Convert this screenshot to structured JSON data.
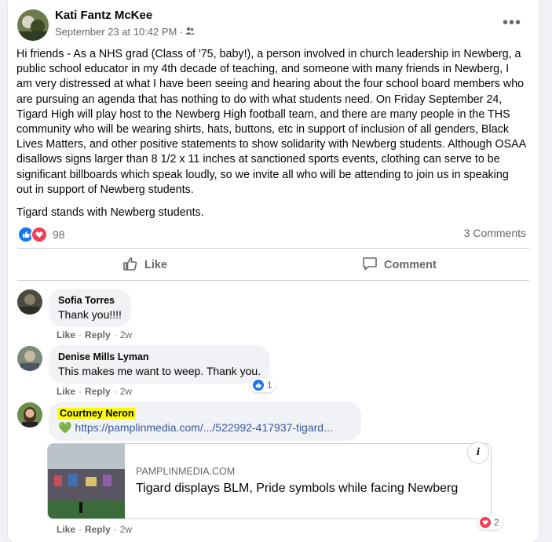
{
  "post": {
    "author": "Kati Fantz McKee",
    "timestamp": "September 23 at 10:42 PM",
    "privacy_icon": "friends-icon",
    "more_label": "•••",
    "paragraph1": "Hi friends - As a NHS grad (Class of '75, baby!), a person involved in church leadership in Newberg, a public school educator in my 4th decade of teaching, and someone with many friends in Newberg, I am very distressed at what I have been seeing and hearing about the four school board members who are pursuing an agenda that has nothing to do with what students need. On Friday September 24, Tigard High will play host to the Newberg High football team, and there are many people in the THS community who will be wearing shirts, hats, buttons, etc in support of inclusion of all genders, Black Lives Matters, and other positive statements to show solidarity with Newberg students. Although OSAA disallows signs larger than 8 1/2 x 11 inches at sanctioned sports events, clothing can serve to be significant billboards which speak loudly, so we invite all who will be attending to join us in speaking out in support of Newberg students.",
    "paragraph2": "Tigard stands with Newberg students.",
    "reaction_count": "98",
    "comments_count": "3 Comments",
    "like_label": "Like",
    "comment_label": "Comment"
  },
  "comments": [
    {
      "name": "Sofia Torres",
      "text": "Thank you!!!!",
      "like": "Like",
      "reply": "Reply",
      "age": "2w"
    },
    {
      "name": "Denise Mills Lyman",
      "text": "This makes me want to weep. Thank you.",
      "like": "Like",
      "reply": "Reply",
      "age": "2w",
      "reactions": "1"
    },
    {
      "name": "Courtney Neron",
      "emoji": "💚",
      "link": "https://pamplinmedia.com/.../522992-417937-tigard...",
      "like": "Like",
      "reply": "Reply",
      "age": "2w",
      "reactions": "2",
      "preview": {
        "domain": "PAMPLINMEDIA.COM",
        "title": "Tigard displays BLM, Pride symbols while facing Newberg",
        "info": "i"
      }
    }
  ],
  "colors": {
    "like_blue": "#1877f2",
    "love_red": "#f33e58",
    "highlight": "#ffff00",
    "link": "#385898"
  }
}
